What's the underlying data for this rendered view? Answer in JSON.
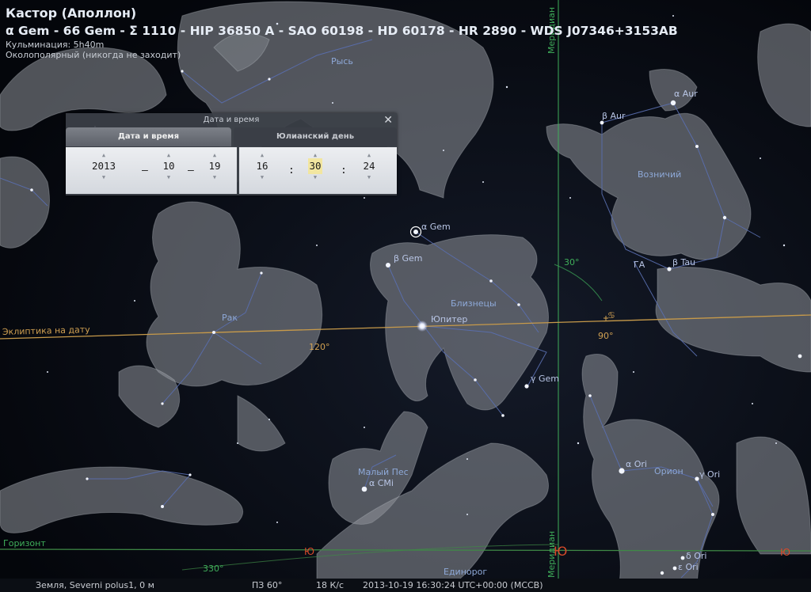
{
  "object_info": {
    "name": "Кастор (Аполлон)",
    "designations": "α Gem - 66 Gem - Σ 1110 - HIP 36850 A - SAO 60198 - HD 60178 - HR 2890 - WDS J07346+3153AB",
    "culmination": "Кульминация: 5h40m",
    "circumpolar": "Околополярный (никогда не заходит)"
  },
  "dialog": {
    "title": "Дата и время",
    "close_symbol": "✕",
    "tabs": [
      "Дата и время",
      "Юлианский день"
    ],
    "year": "2013",
    "month": "10",
    "day": "19",
    "hour": "16",
    "minute": "30",
    "second": "24",
    "date_sep": "–",
    "time_sep": ":",
    "arrow_up": "▲",
    "arrow_down": "▼"
  },
  "sky_labels": {
    "lynx": "Рысь",
    "meridian": "Меридиан",
    "alpha_aur": "α Aur",
    "beta_aur": "β Aur",
    "auriga": "Возничий",
    "alpha_gem": "α Gem",
    "beta_gem": "β Gem",
    "gemini": "Близнецы",
    "jupiter": "Юпитер",
    "gamma_gem": "γ Gem",
    "cancer": "Рак",
    "ecliptic": "Эклиптика на дату",
    "deg_120": "120°",
    "deg_90": "90°",
    "deg_30": "30°",
    "ga": "ГА",
    "beta_tau": "β Tau",
    "canis_minor": "Малый Пес",
    "alpha_cmi": "α CMi",
    "alpha_ori": "α Ori",
    "orion": "Орион",
    "gamma_ori": "γ Ori",
    "horizon": "Горизонт",
    "deg_330": "330°",
    "south": "Ю",
    "south2": "Ю",
    "south3": "Ю",
    "monoceros": "Единорог",
    "delta_ori": "δ Ori",
    "epsilon_ori": "ε Ori",
    "meridian2": "Меридиан",
    "solstice_symbol": "♋"
  },
  "status_bar": {
    "location": "Земля, Severni polus1, 0 м",
    "fov": "ПЗ 60°",
    "fps": "18 К/с",
    "datetime": "2013-10-19 16:30:24 UTC+00:00 (MCCB)"
  },
  "colors": {
    "ecliptic": "#c79a4a",
    "meridian": "#3fae5a",
    "horizon": "#3f8a46",
    "constellation_lines": "#5a6fb0",
    "cardinal": "#d84a2a"
  }
}
